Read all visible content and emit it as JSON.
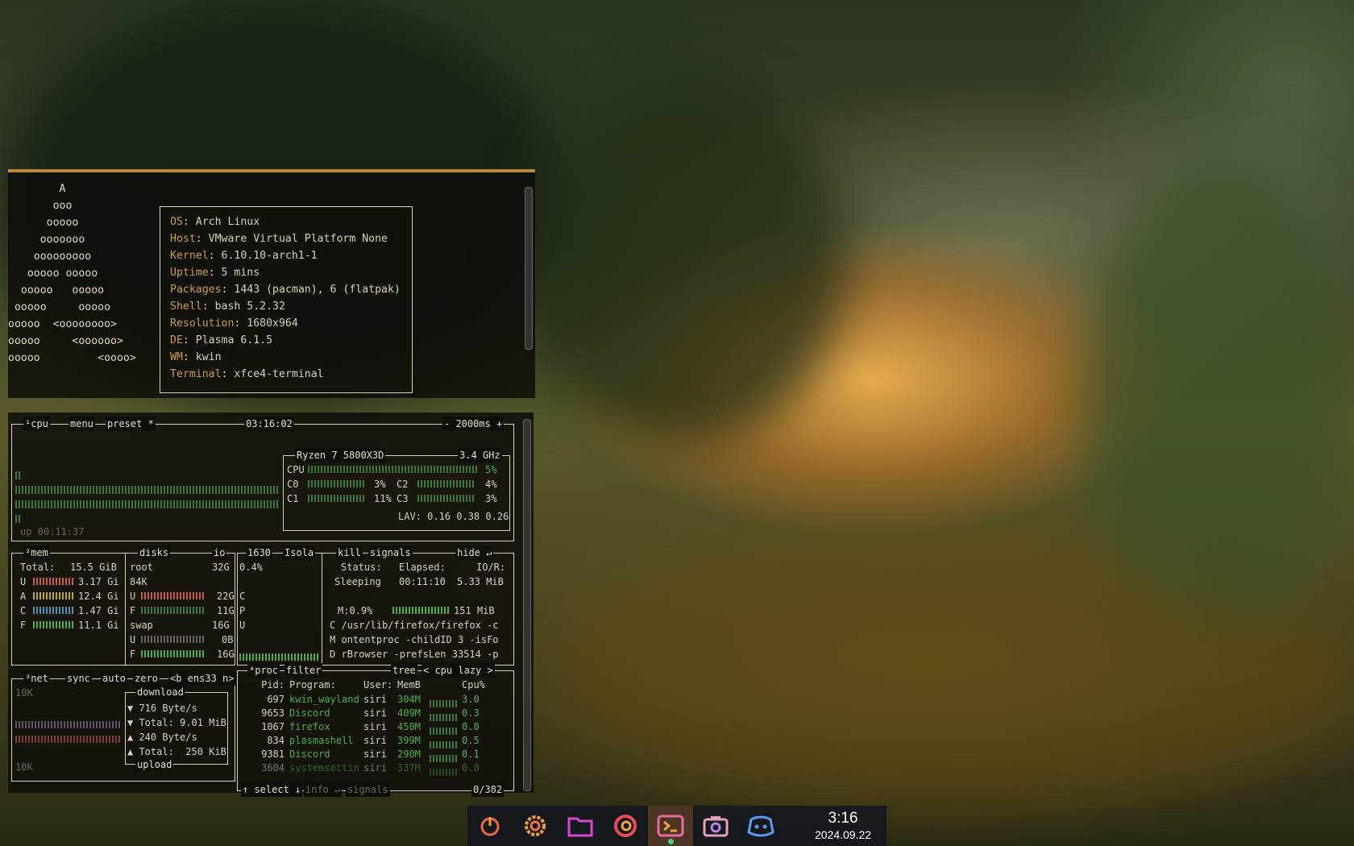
{
  "neofetch": {
    "logo_lines": [
      "        A",
      "       ooo",
      "      ooooo",
      "     ooooooo",
      "    ooooooooo",
      "   ooooo ooooo",
      "  ooooo   ooooo",
      " ooooo     ooooo",
      "ooooo  <oooooooo>",
      "ooooo     <oooooo>",
      "ooooo         <oooo>"
    ],
    "info": [
      {
        "key": "OS",
        "value": "Arch Linux"
      },
      {
        "key": "Host",
        "value": "VMware Virtual Platform None"
      },
      {
        "key": "Kernel",
        "value": "6.10.10-arch1-1"
      },
      {
        "key": "Uptime",
        "value": "5 mins"
      },
      {
        "key": "Packages",
        "value": "1443 (pacman), 6 (flatpak)"
      },
      {
        "key": "Shell",
        "value": "bash 5.2.32"
      },
      {
        "key": "Resolution",
        "value": "1680x964"
      },
      {
        "key": "DE",
        "value": "Plasma 6.1.5"
      },
      {
        "key": "WM",
        "value": "kwin"
      },
      {
        "key": "Terminal",
        "value": "xfce4-terminal"
      }
    ]
  },
  "btop": {
    "cpu": {
      "tab": "¹cpu",
      "menu": "menu",
      "preset": "preset *",
      "time": "03:16:02",
      "interval": "- 2000ms +",
      "uptime": "up 00:11:37",
      "model": "Ryzen 7 5800X3D",
      "freq": "3.4 GHz",
      "total_label": "CPU",
      "total_pct": "5%",
      "cores": [
        {
          "name": "C0",
          "pct": "3%"
        },
        {
          "name": "C1",
          "pct": "11%"
        },
        {
          "name": "C2",
          "pct": "4%"
        },
        {
          "name": "C3",
          "pct": "3%"
        }
      ],
      "lav": "LAV: 0.16 0.38 0.26"
    },
    "mem": {
      "tab": "²mem",
      "total_label": "Total:",
      "total": "15.5 GiB",
      "rows": [
        {
          "k": "U",
          "v": "3.17 Gi"
        },
        {
          "k": "A",
          "v": "12.4 Gi"
        },
        {
          "k": "C",
          "v": "1.47 Gi"
        },
        {
          "k": "F",
          "v": "11.1 Gi"
        }
      ]
    },
    "disks": {
      "tab": "disks",
      "io": "io",
      "root": "root",
      "root_size": "32G",
      "root_io": "84K",
      "rows": [
        {
          "k": "U",
          "v": "22G"
        },
        {
          "k": "F",
          "v": "11G"
        }
      ],
      "swap": "swap",
      "swap_size": "16G",
      "swap_rows": [
        {
          "k": "U",
          "v": "0B"
        },
        {
          "k": "F",
          "v": "16G"
        }
      ]
    },
    "detail": {
      "pid": "1630",
      "name": "Isola",
      "kill": "kill",
      "signals": "signals",
      "hide": "hide ↵",
      "cpu_pct": "0.4%",
      "status_label": "Status:",
      "status": "Sleeping",
      "elapsed_label": "Elapsed:",
      "elapsed": "00:11:10",
      "io_label": "IO/R:",
      "io": "5.33 MiB",
      "mem": "M:0.9%",
      "mem_val": "151 MiB",
      "cmd": [
        "/usr/lib/firefox/firefox -c",
        "ontentproc -childID 3 -isFo",
        "rBrowser -prefsLen 33514 -p"
      ],
      "cmd_prefix": [
        "C",
        "M",
        "D"
      ],
      "side": [
        "C",
        "P",
        "U"
      ]
    },
    "net": {
      "tab": "³net",
      "sync": "sync",
      "auto": "auto",
      "zero": "zero",
      "iface": "<b ens33 n>",
      "scale_top": "10K",
      "scale_bot": "10K",
      "download": "download",
      "dl_rate": "716 Byte/s",
      "dl_total": "Total: 9.01 MiB",
      "ul_rate": "240 Byte/s",
      "ul_total": "Total:  250 KiB",
      "upload": "upload"
    },
    "proc": {
      "tab": "⁴proc",
      "filter": "filter",
      "tree": "tree",
      "sort": "< cpu lazy >",
      "headers": [
        "Pid:",
        "Program:",
        "User:",
        "MemB",
        "Cpu%"
      ],
      "rows": [
        {
          "pid": "697",
          "prog": "kwin_wayland",
          "user": "siri",
          "mem": "304M",
          "cpu": "3.0"
        },
        {
          "pid": "9653",
          "prog": "Discord",
          "user": "siri",
          "mem": "409M",
          "cpu": "0.3"
        },
        {
          "pid": "1067",
          "prog": "firefox",
          "user": "siri",
          "mem": "450M",
          "cpu": "0.0"
        },
        {
          "pid": "834",
          "prog": "plasmashell",
          "user": "siri",
          "mem": "399M",
          "cpu": "0.5"
        },
        {
          "pid": "9381",
          "prog": "Discord",
          "user": "siri",
          "mem": "290M",
          "cpu": "0.1"
        },
        {
          "pid": "3604",
          "prog": "systemsettin",
          "user": "siri",
          "mem": "337M",
          "cpu": "0.0"
        }
      ],
      "footer_select": "↑ select ↓",
      "footer_info": "info ↵",
      "footer_signals": "signals",
      "count": "0/382"
    }
  },
  "taskbar": {
    "time": "3:16",
    "date": "2024.09.22",
    "apps": [
      {
        "icon": "power-icon"
      },
      {
        "icon": "settings-icon"
      },
      {
        "icon": "folder-icon"
      },
      {
        "icon": "firefox-icon"
      },
      {
        "icon": "terminal-icon"
      },
      {
        "icon": "screenshot-icon"
      },
      {
        "icon": "discord-icon"
      }
    ]
  }
}
